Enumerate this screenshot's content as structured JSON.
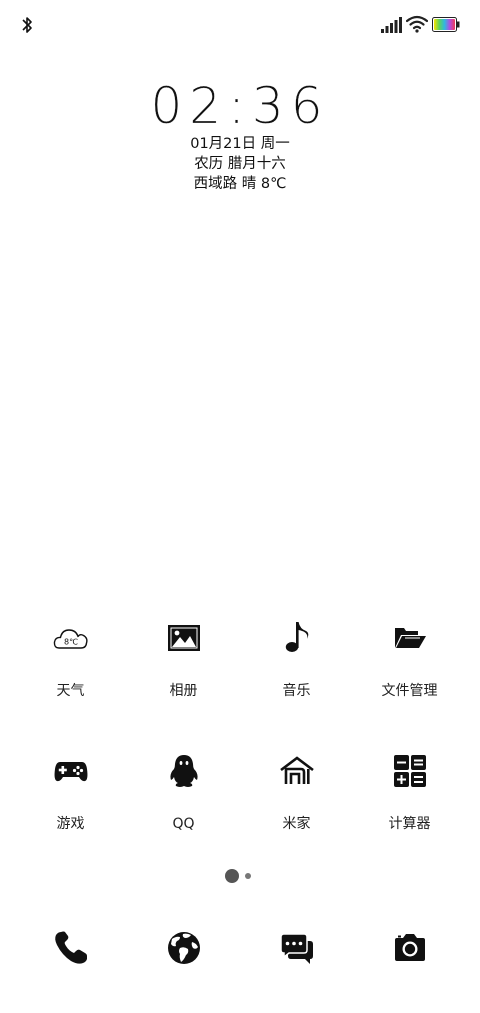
{
  "status_bar": {
    "bluetooth_icon": "bluetooth-icon",
    "signal_icon": "cellular-signal-icon",
    "wifi_icon": "wifi-icon",
    "battery_icon": "battery-icon"
  },
  "clock": {
    "time": "02:36",
    "date": "01月21日 周一",
    "lunar": "农历 腊月十六",
    "weather": "西域路 晴 8℃"
  },
  "apps": [
    {
      "label": "天气",
      "icon": "weather-cloud-icon",
      "badge": "8℃"
    },
    {
      "label": "相册",
      "icon": "gallery-icon"
    },
    {
      "label": "音乐",
      "icon": "music-note-icon"
    },
    {
      "label": "文件管理",
      "icon": "folder-open-icon"
    },
    {
      "label": "游戏",
      "icon": "gamepad-icon"
    },
    {
      "label": "QQ",
      "icon": "qq-penguin-icon"
    },
    {
      "label": "米家",
      "icon": "mi-home-icon"
    },
    {
      "label": "计算器",
      "icon": "calculator-icon"
    }
  ],
  "page_indicator": {
    "pages": 2,
    "current": 1
  },
  "dock": [
    {
      "icon": "phone-icon"
    },
    {
      "icon": "browser-globe-icon"
    },
    {
      "icon": "messages-icon"
    },
    {
      "icon": "camera-icon"
    }
  ],
  "colors": {
    "background": "#ffffff",
    "foreground": "#111111"
  }
}
